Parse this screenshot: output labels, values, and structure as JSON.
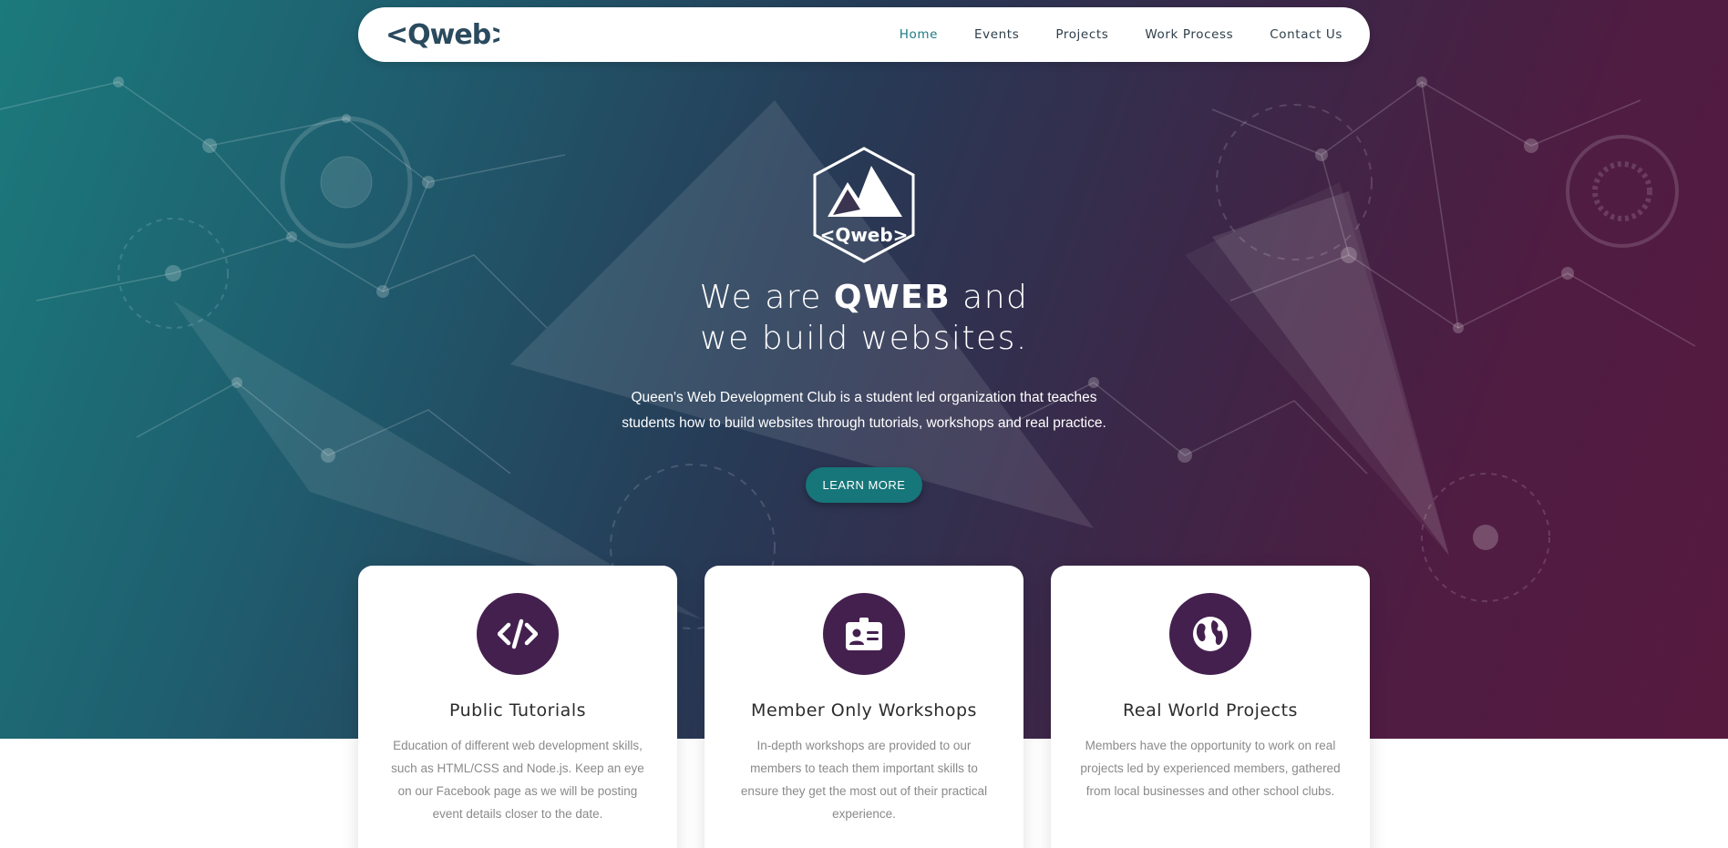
{
  "brand": {
    "logo_text": "<Qweb>",
    "emblem_text": "<Qweb>",
    "colors": {
      "accent": "#16767a",
      "nav_active": "#1c7a80",
      "card_icon_bg": "#44204f"
    }
  },
  "nav": {
    "links": [
      {
        "label": "Home",
        "active": true
      },
      {
        "label": "Events",
        "active": false
      },
      {
        "label": "Projects",
        "active": false
      },
      {
        "label": "Work Process",
        "active": false
      },
      {
        "label": "Contact Us",
        "active": false
      }
    ]
  },
  "hero": {
    "title_prefix": "We are ",
    "title_bold": "QWEB",
    "title_suffix": " and",
    "title_line2": "we build websites.",
    "desc_line1": "Queen's Web Development Club is a student led organization that teaches",
    "desc_line2": "students how to build websites through tutorials, workshops and real practice.",
    "button_label": "LEARN MORE"
  },
  "cards": [
    {
      "icon": "code-icon",
      "title": "Public Tutorials",
      "text": "Education of different web development skills, such as HTML/CSS and Node.js. Keep an eye on our Facebook page as we will be posting event details closer to the date."
    },
    {
      "icon": "id-badge-icon",
      "title": "Member Only Workshops",
      "text": "In-depth workshops are provided to our members to teach them important skills to ensure they get the most out of their practical experience."
    },
    {
      "icon": "globe-icon",
      "title": "Real World Projects",
      "text": "Members have the opportunity to work on real projects led by experienced members, gathered from local businesses and other school clubs."
    }
  ]
}
